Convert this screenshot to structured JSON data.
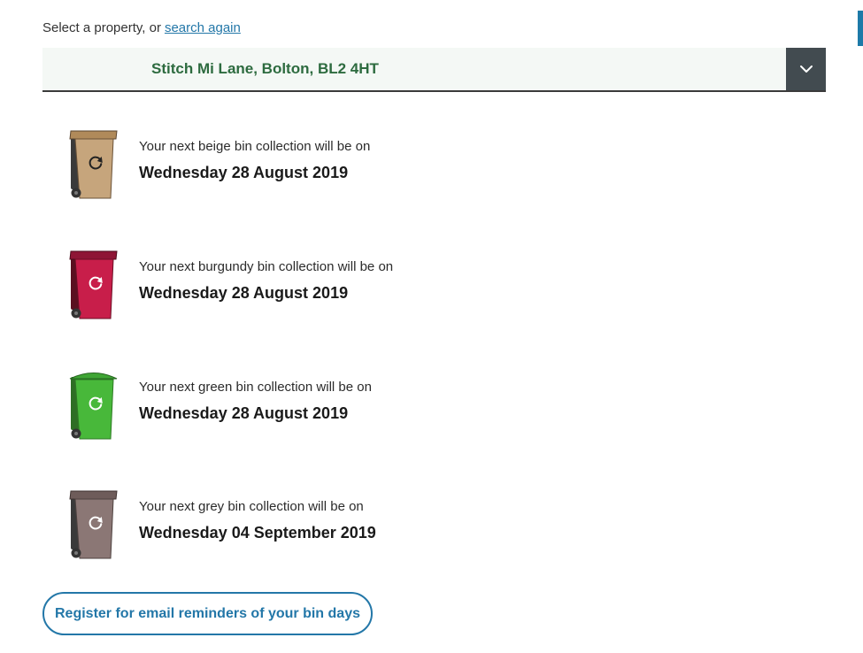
{
  "property_select": {
    "prompt": "Select a property, or",
    "search_link": "search again",
    "selected_value": "Stitch Mi Lane, Bolton, BL2 4HT"
  },
  "bins": [
    {
      "name": "beige",
      "message": "Your next beige bin collection will be on",
      "date": "Wednesday 28 August 2019",
      "icon": "beige-wheelie-bin-icon",
      "color": "#c6a57c"
    },
    {
      "name": "burgundy",
      "message": "Your next burgundy bin collection will be on",
      "date": "Wednesday 28 August 2019",
      "icon": "burgundy-wheelie-bin-icon",
      "color": "#c81e4a"
    },
    {
      "name": "green",
      "message": "Your next green bin collection will be on",
      "date": "Wednesday 28 August 2019",
      "icon": "green-wheelie-bin-icon",
      "color": "#48b83a"
    },
    {
      "name": "grey",
      "message": "Your next grey bin collection will be on",
      "date": "Wednesday 04 September 2019",
      "icon": "grey-wheelie-bin-icon",
      "color": "#8b7775"
    }
  ],
  "reminder_button": {
    "label": "Register for email reminders of your bin days"
  },
  "colors": {
    "link": "#2377a8",
    "address_text": "#2d6b3f",
    "dropdown_toggle": "#424b50",
    "select_background": "#f4f8f5"
  }
}
